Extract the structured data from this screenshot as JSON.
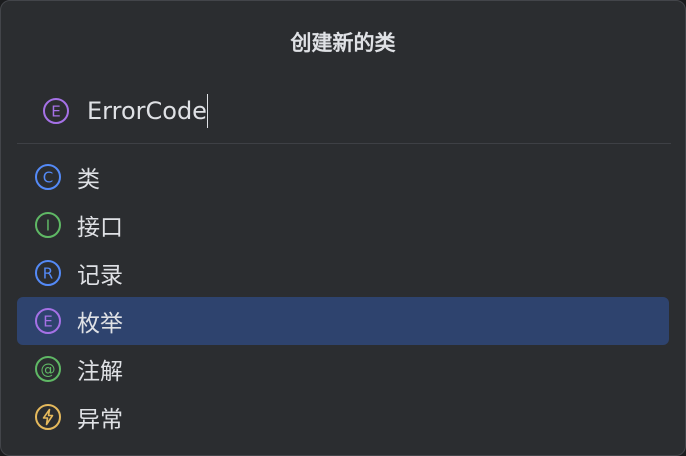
{
  "dialog": {
    "title": "创建新的类"
  },
  "name_field": {
    "value": "ErrorCode",
    "kind_icon": "enum-icon",
    "kind_letter": "E"
  },
  "kinds": [
    {
      "label": "类",
      "icon": "class-icon",
      "letter": "C",
      "color": "#548af7",
      "selected": false
    },
    {
      "label": "接口",
      "icon": "interface-icon",
      "letter": "I",
      "color": "#5fb865",
      "selected": false
    },
    {
      "label": "记录",
      "icon": "record-icon",
      "letter": "R",
      "color": "#548af7",
      "selected": false
    },
    {
      "label": "枚举",
      "icon": "enum-icon",
      "letter": "E",
      "color": "#a571e6",
      "selected": true
    },
    {
      "label": "注解",
      "icon": "annotation-icon",
      "letter": "@",
      "color": "#5fb865",
      "selected": false
    },
    {
      "label": "异常",
      "icon": "exception-icon",
      "letter": "",
      "color": "#e5b95c",
      "selected": false
    }
  ],
  "colors": {
    "background": "#2b2d30",
    "selection": "#2e436e",
    "text": "#dfe1e5",
    "enum": "#a571e6"
  }
}
